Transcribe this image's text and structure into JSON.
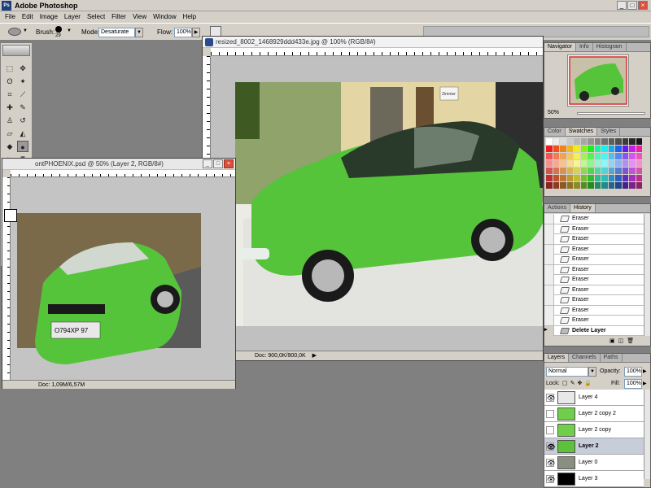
{
  "app": {
    "title": "Adobe Photoshop",
    "logo": "Ps",
    "window_controls": [
      "_",
      "□",
      "×"
    ]
  },
  "menu": [
    "File",
    "Edit",
    "Image",
    "Layer",
    "Select",
    "Filter",
    "View",
    "Window",
    "Help"
  ],
  "options": {
    "brush_label": "Brush:",
    "brush_size": "29",
    "mode_label": "Mode:",
    "mode_value": "Desaturate",
    "flow_label": "Flow:",
    "flow_value": "100%"
  },
  "doc_main": {
    "title": "resized_8002_1468929ddd433e.jpg @ 100% (RGB/8#)",
    "status": "Doc: 900,0K/900,0K"
  },
  "doc_second": {
    "title": "ontPHOENIX.psd @ 50% (Layer 2, RGB/8#)",
    "status": "Doc: 1,09M/6,57M",
    "plate": "O794XP 97"
  },
  "sign_text": "Zimmer",
  "navigator": {
    "tabs": [
      "Navigator",
      "Info",
      "Histogram"
    ],
    "zoom": "50%"
  },
  "swatches": {
    "tabs": [
      "Color",
      "Swatches",
      "Styles"
    ]
  },
  "history": {
    "tabs": [
      "Actions",
      "History"
    ],
    "items": [
      "Eraser",
      "Eraser",
      "Eraser",
      "Eraser",
      "Eraser",
      "Eraser",
      "Eraser",
      "Eraser",
      "Eraser",
      "Eraser",
      "Eraser"
    ],
    "current": "Delete Layer"
  },
  "layers": {
    "tabs": [
      "Layers",
      "Channels",
      "Paths"
    ],
    "blend_mode": "Normal",
    "opacity_label": "Opacity:",
    "opacity": "100%",
    "lock_label": "Lock:",
    "fill_label": "Fill:",
    "fill": "100%",
    "rows": [
      {
        "name": "Layer 4",
        "visible": true,
        "thumb": "#e8e8e8"
      },
      {
        "name": "Layer 2 copy 2",
        "visible": false,
        "thumb": "#6fcf4a"
      },
      {
        "name": "Layer 2 copy",
        "visible": false,
        "thumb": "#6fcf4a"
      },
      {
        "name": "Layer 2",
        "visible": true,
        "thumb": "#5cc23a",
        "selected": true
      },
      {
        "name": "Layer 0",
        "visible": true,
        "thumb": "#8a9080"
      },
      {
        "name": "Layer 3",
        "visible": true,
        "thumb": "#000000"
      }
    ]
  },
  "colors": {
    "car_green": "#56c43a",
    "ui_gray": "#d4d0c8",
    "workspace": "#808080"
  }
}
